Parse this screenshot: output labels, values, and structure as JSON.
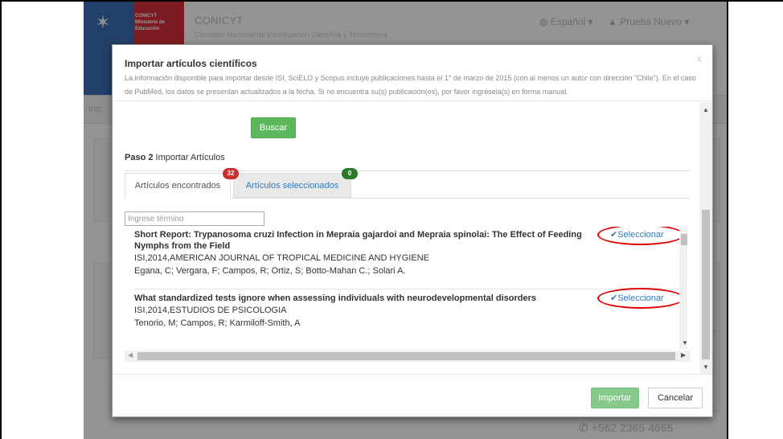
{
  "header": {
    "org_name": "CONICYT",
    "org_full": "Comisión Nacional de Investigación Científica y Tecnológica",
    "brand_line1": "CONICYT",
    "brand_line2": "Ministerio de Educación",
    "language": "Español",
    "user": "Prueba Nuevo"
  },
  "background": {
    "nav_label": "Inic",
    "phone": "+562 2365 4665"
  },
  "modal": {
    "title": "Importar artículos científicos",
    "description": "La información disponible para importar desde ISI, SciELO y Scopus incluye publicaciones hasta el 1° de marzo de 2015 (con al menos un autor con dirección \"Chile\"). En el caso de PubMed, los datos se presentan actualizados a la fecha. Si no encuentra su(s) publicación(es), por favor ingrésela(s) en forma manual.",
    "close": "x",
    "search_button": "Buscar",
    "step_label": "Paso 2",
    "step_text": "Importar Artículos",
    "tabs": [
      {
        "label": "Artículos encontrados",
        "badge": "32",
        "active": true
      },
      {
        "label": "Artículos seleccionados",
        "badge": "0",
        "active": false
      }
    ],
    "filter_placeholder": "Ingrese término",
    "results": [
      {
        "title": "Short Report: Trypanosoma cruzi Infection in Mepraia gajardoi and Mepraia spinolai: The Effect of Feeding Nymphs from the Field",
        "source": "ISI,2014,AMERICAN JOURNAL OF TROPICAL MEDICINE AND HYGIENE",
        "authors": "Egana, C; Vergara, F; Campos, R; Ortiz, S; Botto-Mahan C.; Solari A.",
        "select_label": "Seleccionar"
      },
      {
        "title": "What standardized tests ignore when assessing individuals with neurodevelopmental disorders",
        "source": "ISI,2014,ESTUDIOS DE PSICOLOGIA",
        "authors": "Tenorio, M; Campos, R; Karmiloff-Smith, A",
        "select_label": "Seleccionar"
      }
    ],
    "import_button": "Importar",
    "cancel_button": "Cancelar"
  },
  "colors": {
    "primary_green": "#5cb85c",
    "link_blue": "#337ab7",
    "badge_red": "#c9302c",
    "badge_green": "#2c7a2c",
    "highlight_ring": "#e00000"
  },
  "icons": {
    "select": "check-icon",
    "language": "globe-icon",
    "user": "user-icon",
    "phone": "phone-icon",
    "close": "close-icon"
  }
}
